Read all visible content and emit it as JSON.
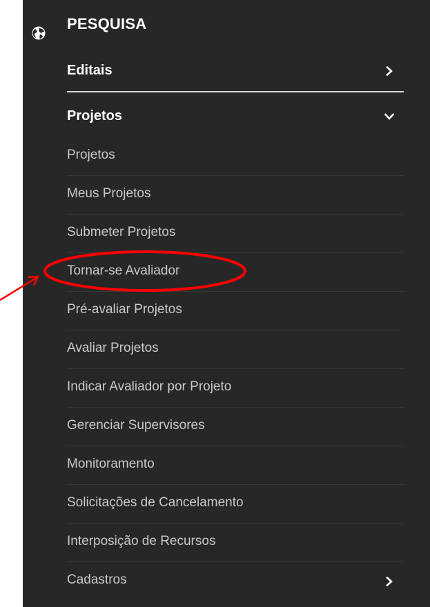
{
  "sidebar": {
    "section_title": "PESQUISA",
    "section_icon": "globe-icon",
    "groups": {
      "editais": {
        "label": "Editais",
        "state": "collapsed"
      },
      "projetos": {
        "label": "Projetos",
        "state": "expanded"
      }
    },
    "items": [
      {
        "label": "Projetos"
      },
      {
        "label": "Meus Projetos"
      },
      {
        "label": "Submeter Projetos"
      },
      {
        "label": "Tornar-se Avaliador"
      },
      {
        "label": "Pré-avaliar Projetos"
      },
      {
        "label": "Avaliar Projetos"
      },
      {
        "label": "Indicar Avaliador por Projeto"
      },
      {
        "label": "Gerenciar Supervisores"
      },
      {
        "label": "Monitoramento"
      },
      {
        "label": "Solicitações de Cancelamento"
      },
      {
        "label": "Interposição de Recursos"
      },
      {
        "label": "Cadastros",
        "has_submenu": true
      }
    ]
  },
  "annotation": {
    "highlighted_item": "Tornar-se Avaliador",
    "color": "#ff0000"
  },
  "colors": {
    "panel_bg": "#272727",
    "heading_text": "#ffffff",
    "item_text": "#c9c9c9"
  }
}
